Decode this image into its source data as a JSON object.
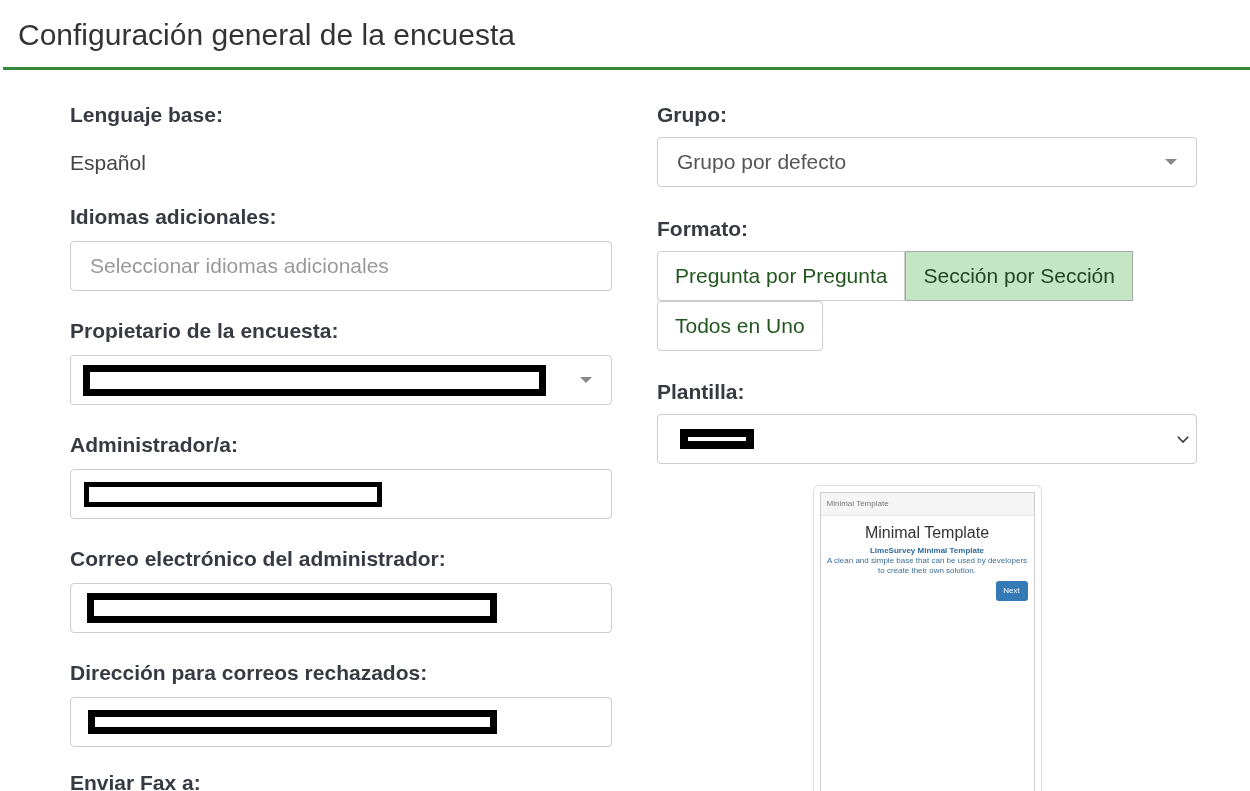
{
  "page_title": "Configuración general de la encuesta",
  "left_fields": [
    {
      "kind": "static",
      "label": "Lenguaje base:",
      "value": "Español"
    },
    {
      "kind": "multiselect",
      "label": "Idiomas adicionales:",
      "placeholder": "Seleccionar idiomas adicionales"
    },
    {
      "kind": "select",
      "label": "Propietario de la encuesta:",
      "redacted": true
    },
    {
      "kind": "text",
      "label": "Administrador/a:",
      "redacted": true
    },
    {
      "kind": "text",
      "label": "Correo electrónico del administrador:",
      "redacted": true
    },
    {
      "kind": "text",
      "label": "Dirección para correos rechazados:",
      "redacted": true
    },
    {
      "kind": "label_only",
      "label": "Enviar Fax a:"
    }
  ],
  "right_fields": [
    {
      "kind": "select",
      "label": "Grupo:",
      "value": "Grupo por defecto"
    },
    {
      "kind": "toggle_group",
      "label": "Formato:",
      "options": [
        {
          "label": "Pregunta por Pregunta",
          "selected": false
        },
        {
          "label": "Sección por Sección",
          "selected": true
        },
        {
          "label": "Todos en Uno",
          "selected": false
        }
      ]
    },
    {
      "kind": "native_select",
      "label": "Plantilla:",
      "redacted": true
    }
  ],
  "template_preview": {
    "title_bar": "Minimal Template",
    "heading": "Minimal Template",
    "subtitle": "LimeSurvey Minimal Template",
    "description": "A clean and simple base that can be used by developers to create their own solution.",
    "button": "Next"
  }
}
